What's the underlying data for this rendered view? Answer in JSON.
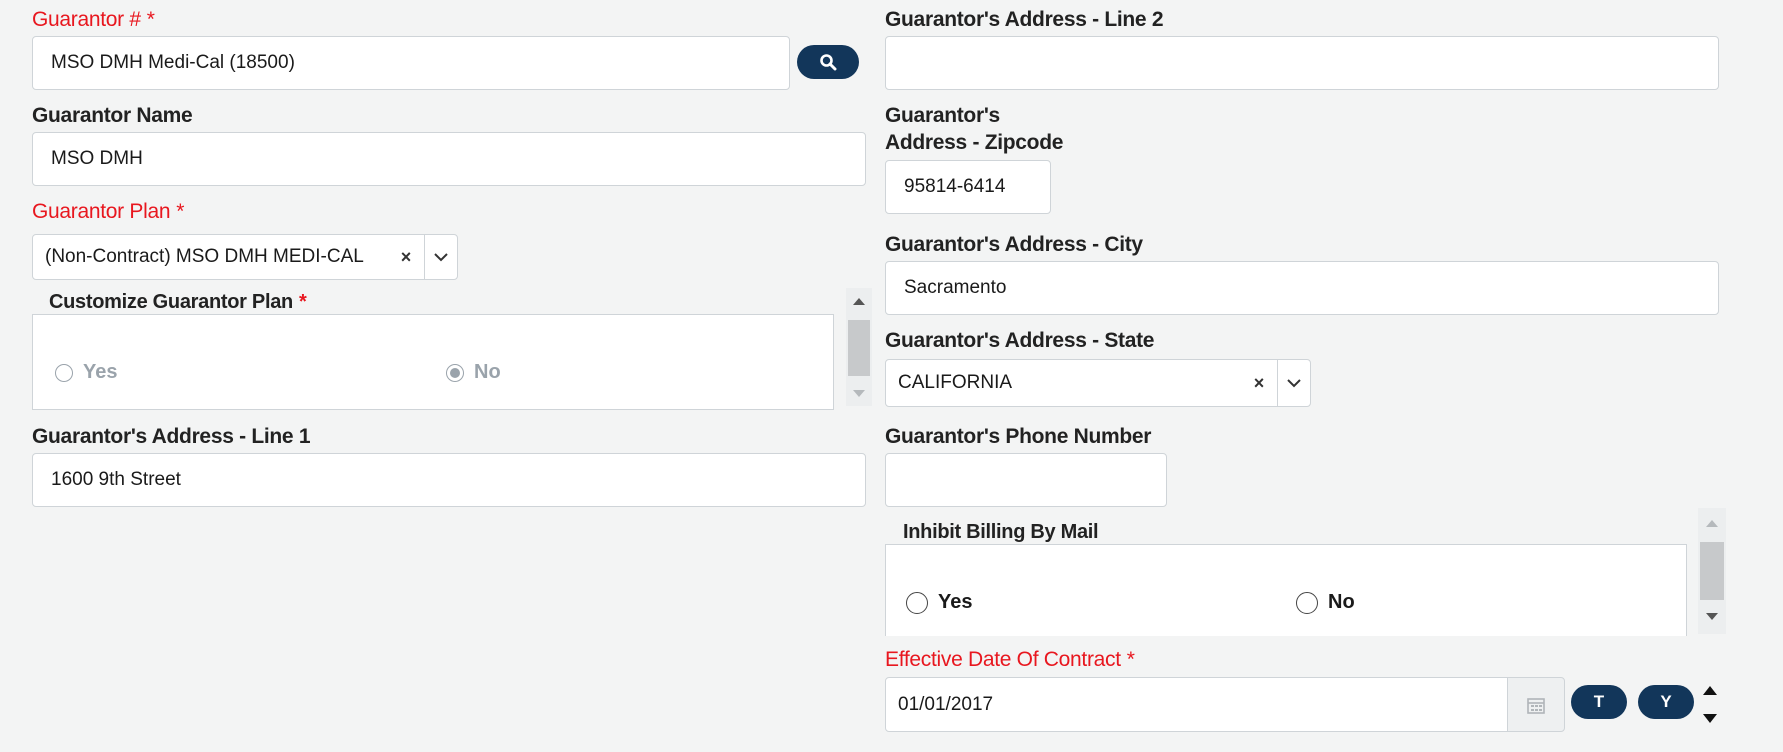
{
  "guarantor_number": {
    "label": "Guarantor #",
    "required_mark": "*",
    "value": "MSO DMH Medi-Cal (18500)"
  },
  "guarantor_name": {
    "label": "Guarantor Name",
    "value": "MSO DMH"
  },
  "guarantor_plan": {
    "label": "Guarantor Plan",
    "required_mark": "*",
    "value": "(Non-Contract) MSO DMH MEDI-CAL",
    "clear_glyph": "×"
  },
  "customize_plan": {
    "legend": "Customize Guarantor Plan",
    "required_mark": "*",
    "options": [
      "Yes",
      "No"
    ],
    "selected": "No",
    "disabled": true
  },
  "address_line1": {
    "label": "Guarantor's Address - Line 1",
    "value": "1600 9th Street"
  },
  "address_line2": {
    "label": "Guarantor's Address - Line 2",
    "value": ""
  },
  "zipcode": {
    "label_line1": "Guarantor's",
    "label_line2": "Address - Zipcode",
    "value": "95814-6414"
  },
  "city": {
    "label": "Guarantor's Address - City",
    "value": "Sacramento"
  },
  "state": {
    "label": "Guarantor's Address - State",
    "value": "CALIFORNIA",
    "clear_glyph": "×"
  },
  "phone": {
    "label": "Guarantor's Phone Number",
    "value": ""
  },
  "inhibit_billing": {
    "legend": "Inhibit Billing By Mail",
    "options": [
      "Yes",
      "No"
    ],
    "selected": null
  },
  "effective_date": {
    "label": "Effective Date Of Contract",
    "required_mark": "*",
    "value": "01/01/2017",
    "today_button": "T",
    "yesterday_button": "Y"
  },
  "colors": {
    "accent": "#12365a",
    "required": "#e8171f",
    "border": "#cfd4d8",
    "background": "#f3f4f4"
  }
}
